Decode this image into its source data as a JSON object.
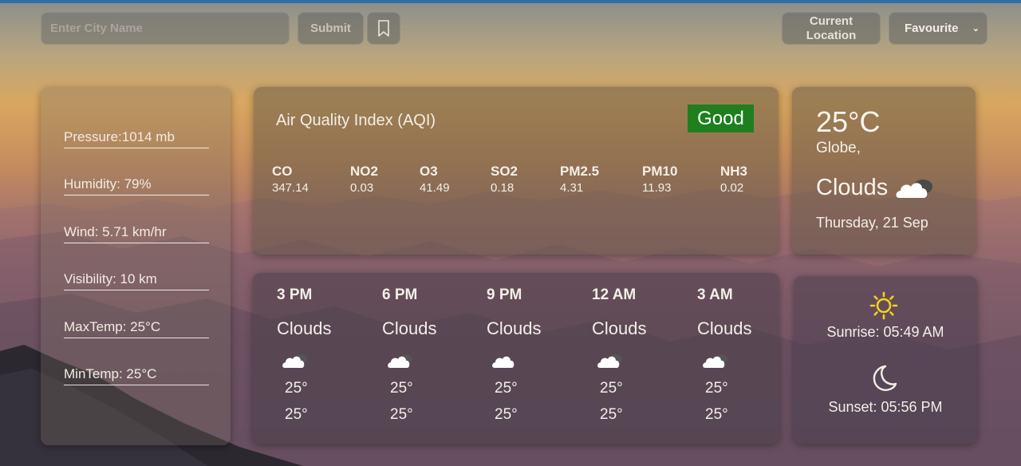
{
  "search": {
    "placeholder": "Enter City Name",
    "value": ""
  },
  "toolbar": {
    "submit_label": "Submit",
    "bookmark_icon": "bookmark-icon",
    "current_location_label": "Current Location",
    "favourite_label": "Favourite"
  },
  "details": [
    {
      "label": "Pressure:1014 mb"
    },
    {
      "label": "Humidity: 79%"
    },
    {
      "label": "Wind: 5.71 km/hr"
    },
    {
      "label": "Visibility: 10 km"
    },
    {
      "label": "MaxTemp: 25°C"
    },
    {
      "label": "MinTemp: 25°C"
    }
  ],
  "aqi": {
    "title": "Air Quality Index (AQI)",
    "status": "Good",
    "status_color": "#1f7f1f",
    "pollutants": [
      {
        "name": "CO",
        "value": "347.14"
      },
      {
        "name": "NO2",
        "value": "0.03"
      },
      {
        "name": "O3",
        "value": "41.49"
      },
      {
        "name": "SO2",
        "value": "0.18"
      },
      {
        "name": "PM2.5",
        "value": "4.31"
      },
      {
        "name": "PM10",
        "value": "11.93"
      },
      {
        "name": "NH3",
        "value": "0.02"
      }
    ]
  },
  "current": {
    "temp": "25°C",
    "city": "Globe,",
    "condition": "Clouds",
    "condition_icon": "cloud-icon",
    "date": "Thursday, 21 Sep"
  },
  "forecast": [
    {
      "time": "3 PM",
      "condition": "Clouds",
      "icon": "cloud-icon",
      "hi": "25°",
      "lo": "25°"
    },
    {
      "time": "6 PM",
      "condition": "Clouds",
      "icon": "cloud-icon",
      "hi": "25°",
      "lo": "25°"
    },
    {
      "time": "9 PM",
      "condition": "Clouds",
      "icon": "cloud-icon",
      "hi": "25°",
      "lo": "25°"
    },
    {
      "time": "12 AM",
      "condition": "Clouds",
      "icon": "cloud-icon",
      "hi": "25°",
      "lo": "25°"
    },
    {
      "time": "3 AM",
      "condition": "Clouds",
      "icon": "cloud-icon",
      "hi": "25°",
      "lo": "25°"
    }
  ],
  "sun": {
    "sunrise": "Sunrise: 05:49 AM",
    "sunset": "Sunset: 05:56 PM",
    "sunrise_icon": "sun-icon",
    "sunset_icon": "moon-icon",
    "sun_color": "#f2d21b"
  }
}
